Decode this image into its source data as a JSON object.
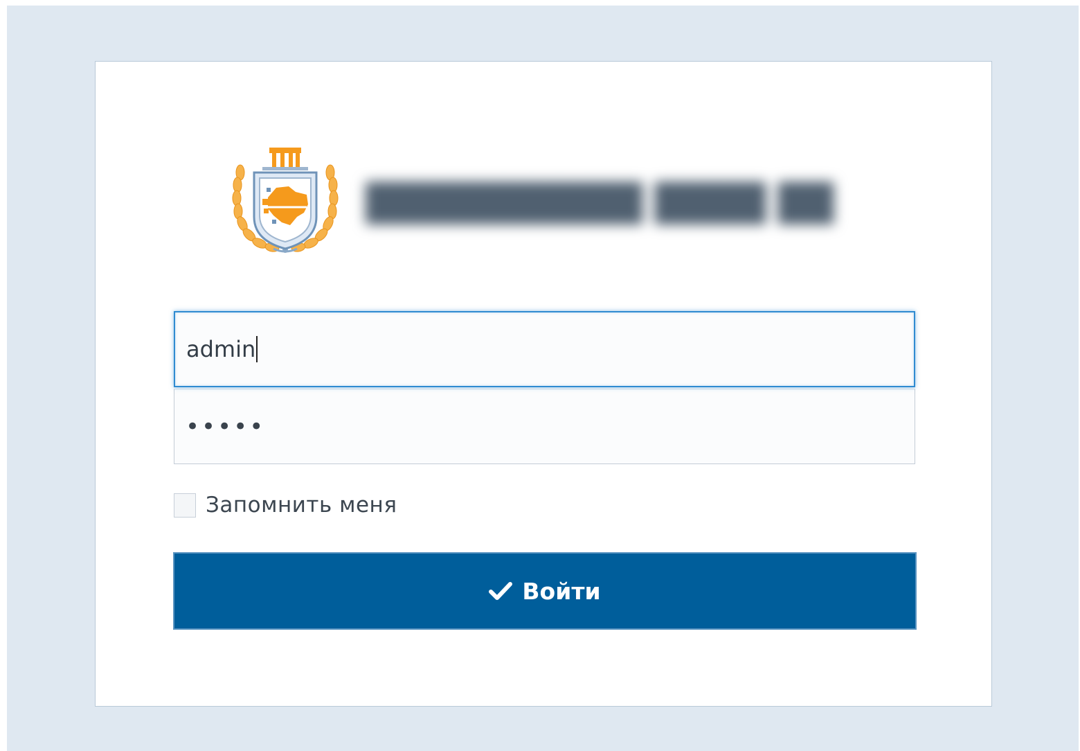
{
  "brand": {
    "logo_icon": "coat-of-arms-emblem",
    "org_name_blurred": "██████████ ████ ██"
  },
  "form": {
    "login_value": "admin",
    "password_mask": "•••••",
    "remember_label": "Запомнить меня",
    "remember_checked": false,
    "submit_label": "Войти",
    "submit_icon": "check-icon"
  },
  "colors": {
    "page_background": "#dfe8f1",
    "button_background": "#005e9b",
    "focus_border": "#2f8bd1",
    "emblem_orange": "#f59a1c"
  }
}
